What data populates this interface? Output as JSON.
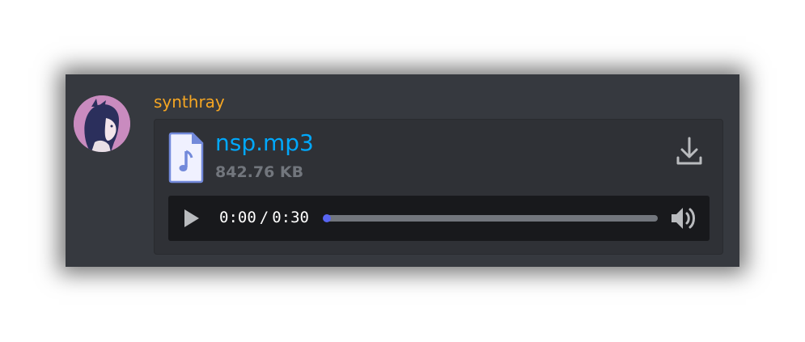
{
  "message": {
    "username": "synthray",
    "username_color": "#f5a623",
    "avatar_icon": "anime-girl-avatar"
  },
  "attachment": {
    "file_name": "nsp.mp3",
    "file_size": "842.76 KB",
    "file_icon": "audio-file-icon",
    "download_icon": "download-icon",
    "link_color": "#00a8fc"
  },
  "player": {
    "current_time": "0:00",
    "separator": "/",
    "duration": "0:30",
    "progress_fraction": 0.0,
    "play_icon": "play-icon",
    "volume_icon": "volume-icon",
    "accent_color": "#5865f2"
  }
}
